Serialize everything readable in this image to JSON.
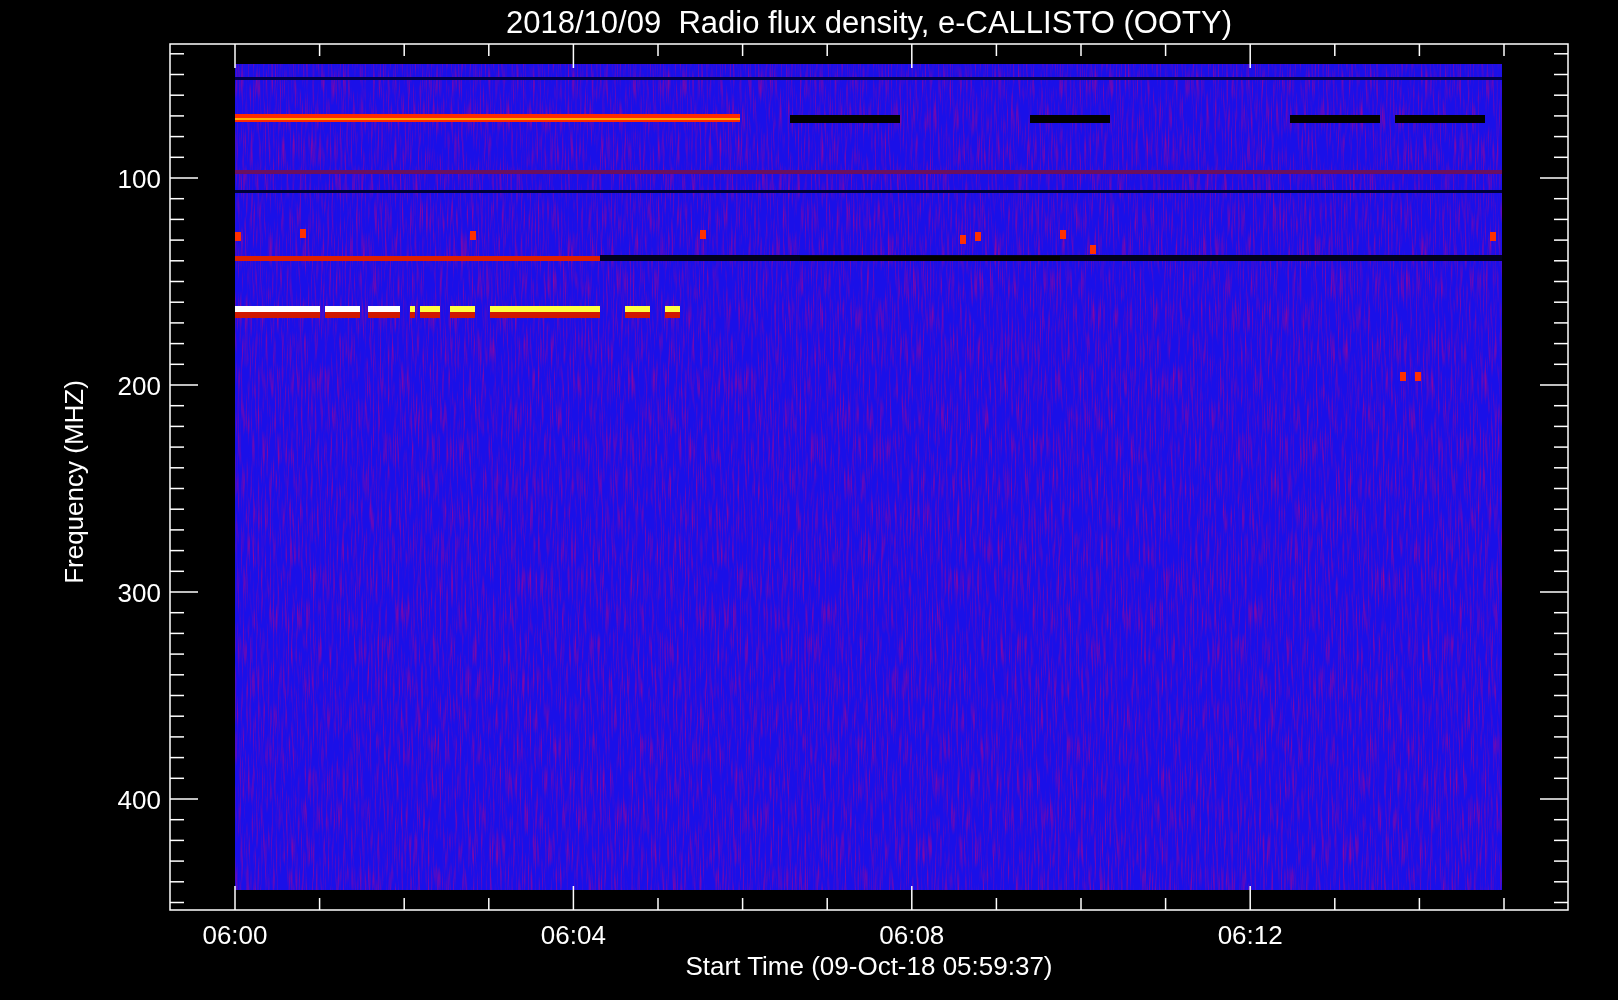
{
  "title": "2018/10/09  Radio flux density, e-CALLISTO (OOTY)",
  "y_axis": {
    "label": "Frequency (MHZ)",
    "ticks": [
      "100",
      "200",
      "300",
      "400"
    ]
  },
  "x_axis": {
    "label": "Start Time (09-Oct-18 05:59:37)",
    "ticks": [
      "06:00",
      "06:04",
      "06:08",
      "06:12"
    ]
  }
}
